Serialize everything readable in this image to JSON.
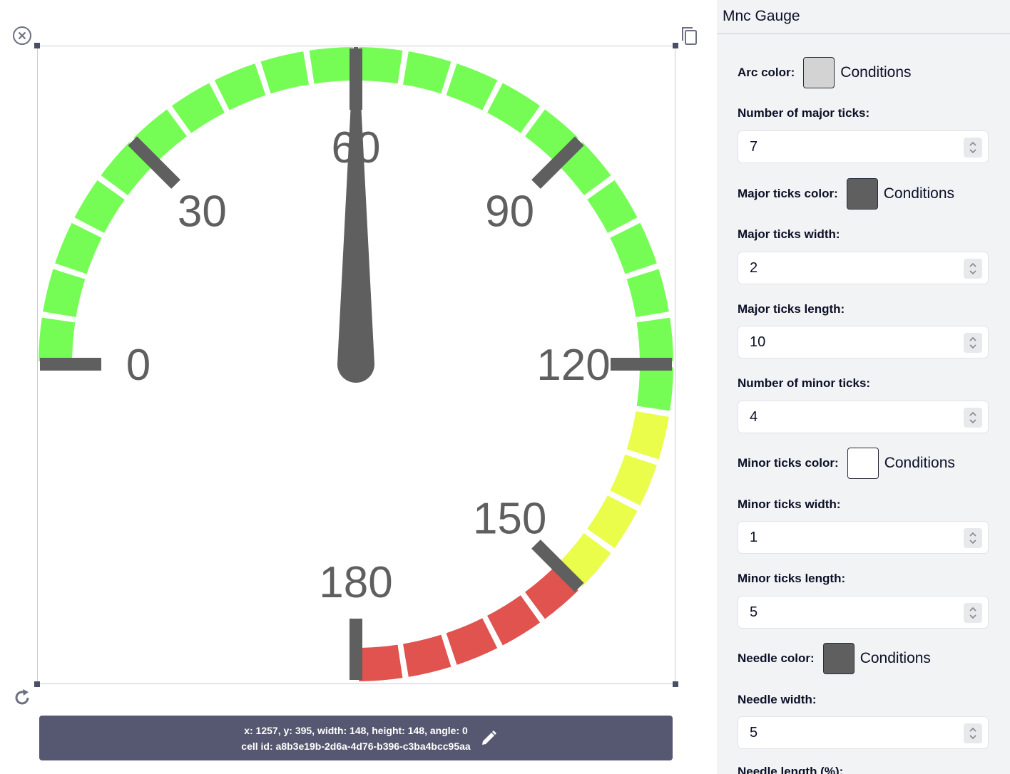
{
  "gauge": {
    "min": 0,
    "max": 180,
    "value": 60,
    "major_tick_labels": [
      "0",
      "30",
      "60",
      "90",
      "120",
      "150",
      "180"
    ],
    "zones": [
      {
        "from": 0,
        "to": 125,
        "color": "#76fd55"
      },
      {
        "from": 125,
        "to": 150,
        "color": "#ebfd4b"
      },
      {
        "from": 150,
        "to": 180,
        "color": "#e0534f"
      }
    ],
    "tick_color": "#5f5f5f",
    "needle_color": "#5f5f5f"
  },
  "info_bar": {
    "geometry_text": "x: 1257, y: 395, width: 148, height: 148, angle: 0",
    "cell_text": "cell id: a8b3e19b-2d6a-4d76-b396-c3ba4bcc95aa"
  },
  "icons": {
    "close": "close-circle-icon",
    "copy": "copy-icon",
    "rotate": "rotate-icon",
    "edit": "pencil-icon"
  },
  "panel": {
    "title": "Mnc Gauge",
    "conditions_label": "Conditions",
    "arc_color": {
      "label": "Arc color:",
      "value": "#d3d3d3"
    },
    "major_ticks_number": {
      "label": "Number of major ticks:",
      "value": "7"
    },
    "major_ticks_color": {
      "label": "Major ticks color:",
      "value": "#5f5f5f"
    },
    "major_ticks_width": {
      "label": "Major ticks width:",
      "value": "2"
    },
    "major_ticks_length": {
      "label": "Major ticks length:",
      "value": "10"
    },
    "minor_ticks_number": {
      "label": "Number of minor ticks:",
      "value": "4"
    },
    "minor_ticks_color": {
      "label": "Minor ticks color:",
      "value": "#ffffff"
    },
    "minor_ticks_width": {
      "label": "Minor ticks width:",
      "value": "1"
    },
    "minor_ticks_length": {
      "label": "Minor ticks length:",
      "value": "5"
    },
    "needle_color": {
      "label": "Needle color:",
      "value": "#5f5f5f"
    },
    "needle_width": {
      "label": "Needle width:",
      "value": "5"
    },
    "needle_length": {
      "label": "Needle length (%):"
    }
  }
}
